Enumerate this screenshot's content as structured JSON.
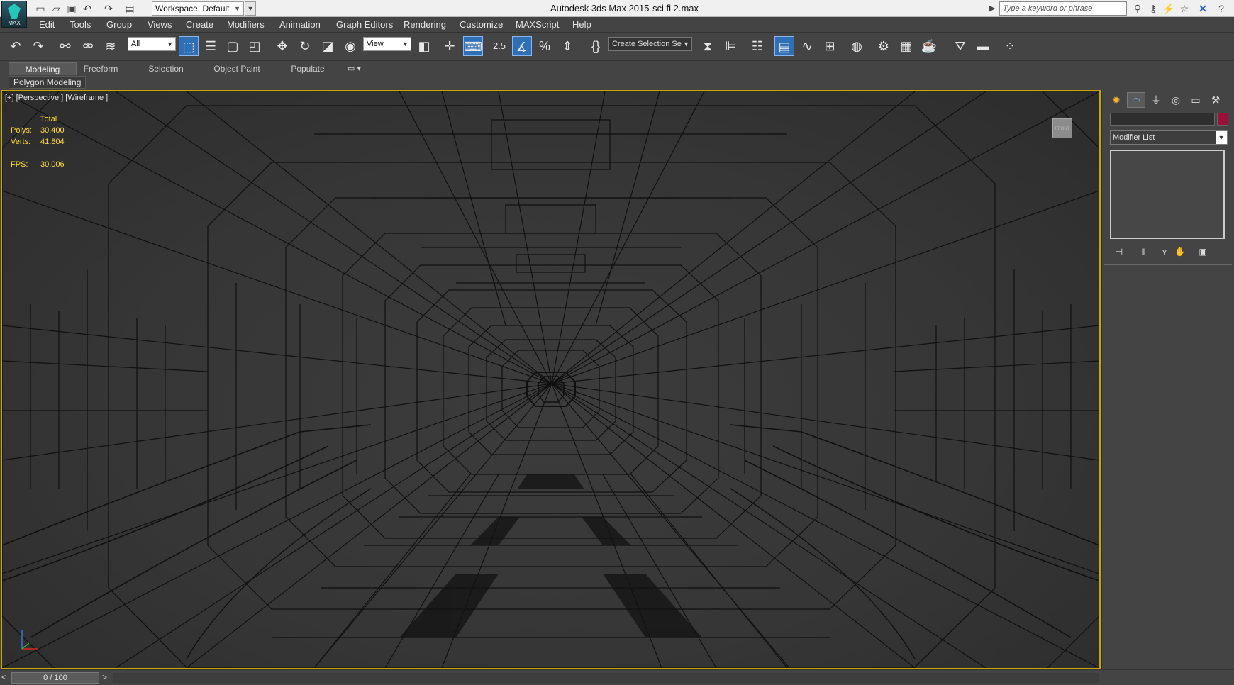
{
  "titlebar": {
    "logo_text": "MAX",
    "workspace": "Workspace: Default",
    "app_title": "Autodesk 3ds Max  2015",
    "file_name": "sci fi 2.max",
    "search_placeholder": "Type a keyword or phrase"
  },
  "menu": [
    {
      "label": "Edit"
    },
    {
      "label": "Tools"
    },
    {
      "label": "Group"
    },
    {
      "label": "Views"
    },
    {
      "label": "Create"
    },
    {
      "label": "Modifiers"
    },
    {
      "label": "Animation"
    },
    {
      "label": "Graph Editors"
    },
    {
      "label": "Rendering"
    },
    {
      "label": "Customize"
    },
    {
      "label": "MAXScript"
    },
    {
      "label": "Help"
    }
  ],
  "toolbar": {
    "selection_filter": "All",
    "reference_coord": "View",
    "snap_label": "2.5",
    "named_selection": "Create Selection Se"
  },
  "ribbon": {
    "tabs": [
      "Modeling",
      "Freeform",
      "Selection",
      "Object Paint",
      "Populate"
    ],
    "active_tab": "Modeling",
    "panel": "Polygon Modeling"
  },
  "viewport": {
    "label": "[+] [Perspective ] [Wireframe ]",
    "stats": {
      "total_label": "Total",
      "polys_label": "Polys:",
      "polys_value": "30.400",
      "verts_label": "Verts:",
      "verts_value": "41.804",
      "fps_label": "FPS:",
      "fps_value": "30,006"
    },
    "viewcube_label": "FRONT",
    "border_color": "#c9a700"
  },
  "command_panel": {
    "modifier_list": "Modifier List",
    "object_color": "#9a1038"
  },
  "timeslider": {
    "frame": "0 / 100",
    "prev": "<",
    "next": ">"
  }
}
